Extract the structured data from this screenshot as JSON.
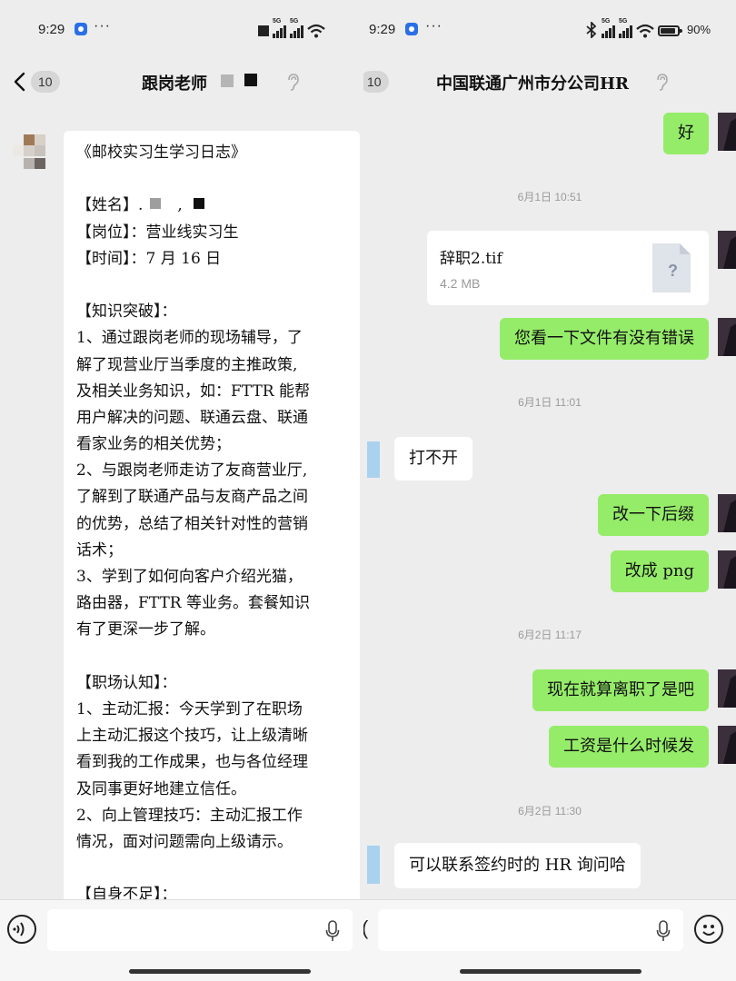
{
  "left": {
    "status": {
      "time": "9:29",
      "dots": "···"
    },
    "nav": {
      "badge": "10",
      "title": "跟岗老师"
    },
    "diary_lines": [
      "《邮校实习生学习日志》",
      "",
      "【姓名】.",
      "【岗位】：营业线实习生",
      "【时间】：7 月 16 日",
      "",
      "【知识突破】：",
      "1、通过跟岗老师的现场辅导，了",
      "解了现营业厅当季度的主推政策,",
      "及相关业务知识，如：FTTR 能帮",
      "用户解决的问题、联通云盘、联通",
      "看家业务的相关优势；",
      "2、与跟岗老师走访了友商营业厅,",
      "了解到了联通产品与友商产品之间",
      "的优势，总结了相关针对性的营销",
      "话术；",
      "3、学到了如何向客户介绍光猫，",
      "路由器，FTTR 等业务。套餐知识",
      "有了更深一步了解。",
      "",
      "【职场认知】：",
      "1、主动汇报：今天学到了在职场",
      "上主动汇报这个技巧，让上级清晰",
      "看到我的工作成果，也与各位经理",
      "及同事更好地建立信任。",
      "2、向上管理技巧：主动汇报工作",
      "情况，面对问题需向上级请示。",
      "",
      "【自身不足】："
    ]
  },
  "right": {
    "status": {
      "time": "9:29",
      "dots": "···",
      "battery": "90%"
    },
    "nav": {
      "badge": "10",
      "title": "中国联通广州市分公司HR"
    },
    "msg_ok": "好",
    "ts1": "6月1日  10:51",
    "file": {
      "name": "辞职2.tif",
      "size": "4.2 MB",
      "icon_glyph": "?"
    },
    "msg_check": "您看一下文件有没有错误",
    "ts2": "6月1日  11:01",
    "msg_cant_open": "打不开",
    "msg_change_ext": "改一下后缀",
    "msg_to_png": "改成 png",
    "ts3": "6月2日  11:17",
    "msg_resigned": "现在就算离职了是吧",
    "msg_salary": "工资是什么时候发",
    "ts4": "6月2日  11:30",
    "msg_contact": "可以联系签约时的 HR 询问哈"
  },
  "colors": {
    "bubble_green": "#95ec69",
    "bubble_white": "#ffffff",
    "background": "#ededed"
  },
  "icons": [
    "back-icon",
    "ear-icon",
    "file-unknown-icon",
    "voice-icon",
    "mic-icon",
    "emoji-icon"
  ]
}
